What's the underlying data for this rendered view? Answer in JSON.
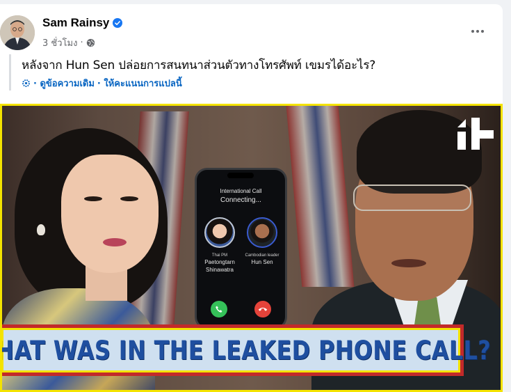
{
  "post": {
    "author": "Sam Rainsy",
    "time": "3 ชั่วโมง",
    "separator": "·",
    "caption": "หลังจาก Hun Sen ปล่อยการสนทนาส่วนตัวทางโทรศัพท์ เขมรได้อะไร?",
    "see_original": "· ดูข้อความเดิม",
    "rate_translation": "· ให้คะแนนการแปลนี้"
  },
  "thumbnail": {
    "phone": {
      "title": "International Call",
      "status": "Connecting...",
      "left_role": "Thai PM",
      "left_name_1": "Paetongtarn",
      "left_name_2": "Shinawatra",
      "right_role": "Cambodian leader",
      "right_name": "Hun Sen"
    },
    "banner": "WHAT WAS IN THE LEAKED PHONE CALL?"
  },
  "colors": {
    "verified": "#1877f2",
    "link": "#0a66c2",
    "banner_text": "#1f4fa0",
    "banner_border": "#c22a2a",
    "frame": "#f4e300"
  },
  "icons": [
    "verified-badge-icon",
    "globe-icon",
    "more-options-icon",
    "translate-gear-icon",
    "phone-accept-icon",
    "phone-decline-icon"
  ]
}
